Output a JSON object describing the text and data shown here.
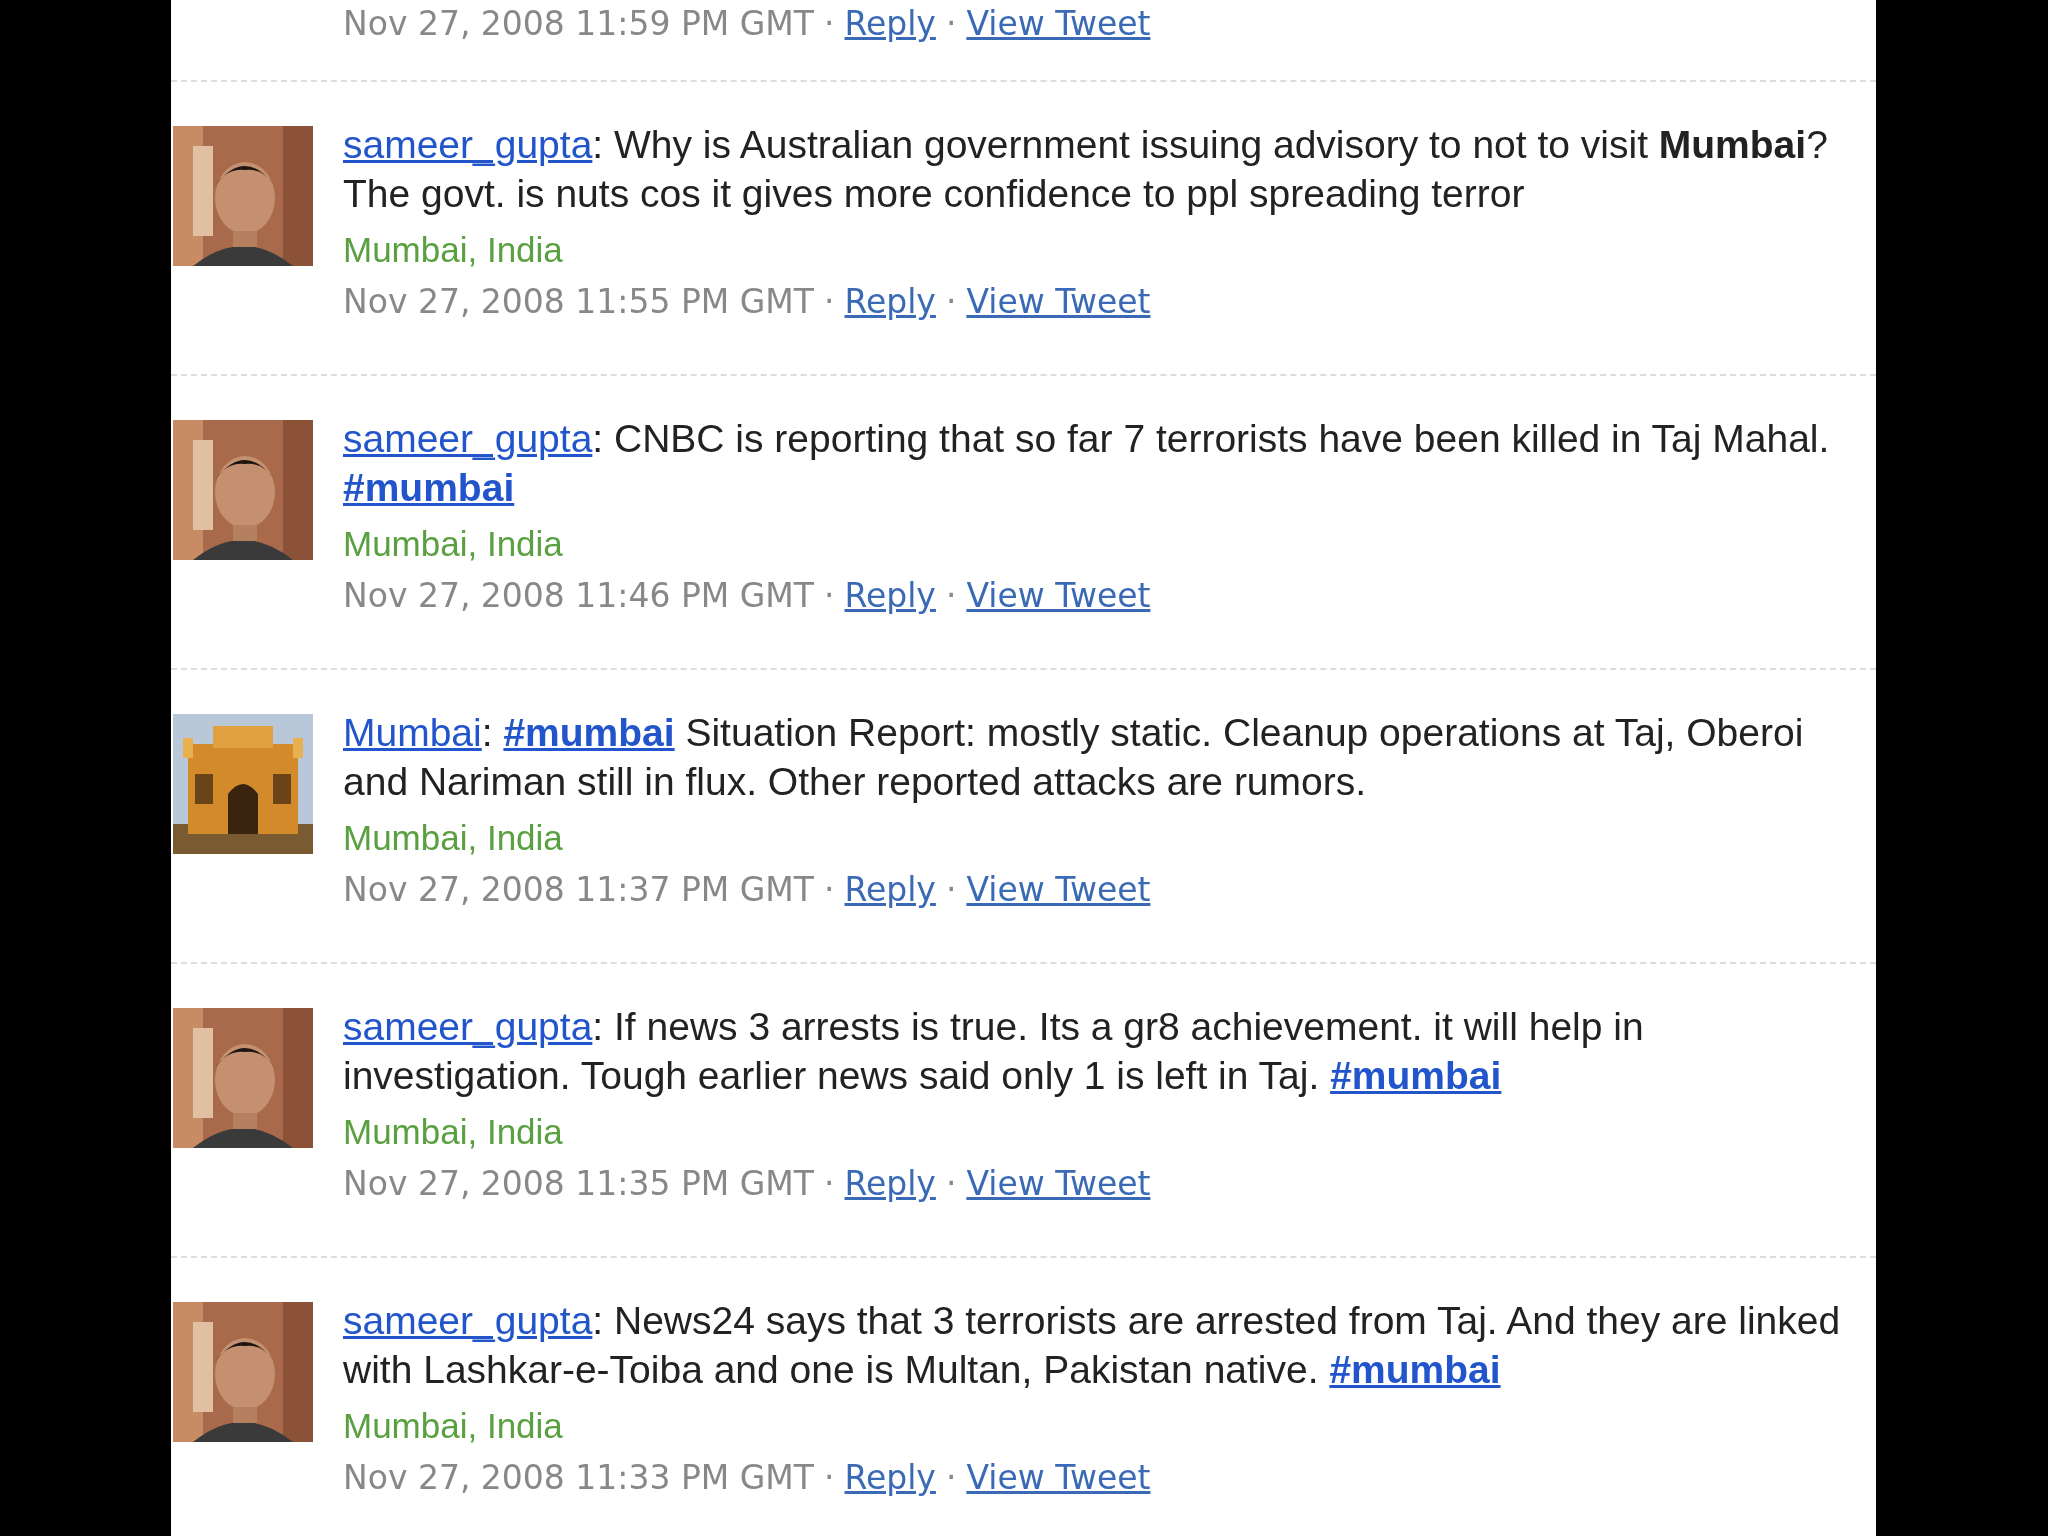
{
  "top_meta": {
    "date": "Nov 27, 2008 11:59 PM GMT",
    "sep": "·",
    "reply": "Reply",
    "view": "View Tweet"
  },
  "tweets": [
    {
      "avatar": {
        "kind": "picture"
      },
      "user": "sameer_gupta",
      "parts": [
        {
          "kind": "text",
          "text": ": Why is Australian government issuing advisory to not to visit **Mumbai**? The govt. is nuts cos it gives more confidence to ppl spreading terror"
        }
      ],
      "location": "Mumbai, India",
      "date": "Nov 27, 2008 11:55 PM GMT",
      "sep": "·",
      "reply": "Reply",
      "view": "View Tweet"
    },
    {
      "avatar": {
        "kind": "picture"
      },
      "user": "sameer_gupta",
      "parts": [
        {
          "kind": "text",
          "text": ": CNBC is reporting that so far 7 terrorists have been killed in Taj Mahal. "
        },
        {
          "kind": "hashtag",
          "text": "#mumbai"
        }
      ],
      "location": "Mumbai, India",
      "date": "Nov 27, 2008 11:46 PM GMT",
      "sep": "·",
      "reply": "Reply",
      "view": "View Tweet"
    },
    {
      "avatar": {
        "kind": "picture"
      },
      "user": "Mumbai",
      "parts": [
        {
          "kind": "text",
          "text": ": "
        },
        {
          "kind": "hashtag",
          "text": "#mumbai"
        },
        {
          "kind": "text",
          "text": " Situation Report: mostly static. Cleanup operations at Taj, Oberoi and Nariman still in flux. Other reported attacks are rumors."
        }
      ],
      "location": "Mumbai, India",
      "date": "Nov 27, 2008 11:37 PM GMT",
      "sep": "·",
      "reply": "Reply",
      "view": "View Tweet"
    },
    {
      "avatar": {
        "kind": "picture"
      },
      "user": "sameer_gupta",
      "parts": [
        {
          "kind": "text",
          "text": ": If news 3 arrests is true. Its a gr8 achievement. it will help in investigation. Tough earlier news said only 1 is left in Taj. "
        },
        {
          "kind": "hashtag",
          "text": "#mumbai"
        }
      ],
      "location": "Mumbai, India",
      "date": "Nov 27, 2008 11:35 PM GMT",
      "sep": "·",
      "reply": "Reply",
      "view": "View Tweet"
    },
    {
      "avatar": {
        "kind": "picture"
      },
      "user": "sameer_gupta",
      "parts": [
        {
          "kind": "text",
          "text": ": News24 says that 3 terrorists are arrested from Taj. And they are linked with Lashkar-e-Toiba and one is Multan, Pakistan native. "
        },
        {
          "kind": "hashtag",
          "text": "#mumbai"
        }
      ],
      "location": "Mumbai, India",
      "date": "Nov 27, 2008 11:33 PM GMT",
      "sep": "·",
      "reply": "Reply",
      "view": "View Tweet"
    }
  ]
}
